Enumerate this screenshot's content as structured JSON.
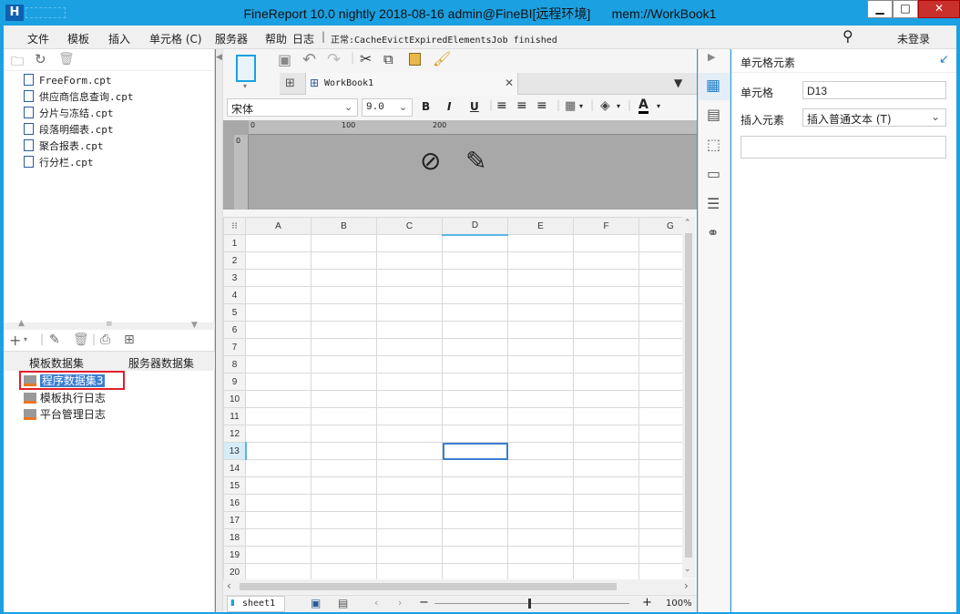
{
  "title": "FineReport 10.0 nightly 2018-08-16 admin@FineBI[远程环境]      mem://WorkBook1",
  "window_controls": {
    "minimize": "▁",
    "maximize": "□",
    "close": "✕"
  },
  "menu": {
    "items": [
      "文件",
      "模板",
      "插入",
      "单元格 (C)",
      "服务器",
      "帮助"
    ],
    "log": "日志",
    "status": "正常:CacheEvictExpiredElementsJob finished",
    "login": "未登录"
  },
  "files": [
    "FreeForm.cpt",
    "供应商信息查询.cpt",
    "分片与冻结.cpt",
    "段落明细表.cpt",
    "聚合报表.cpt",
    "行分栏.cpt"
  ],
  "dataset_tabs": [
    "模板数据集",
    "服务器数据集"
  ],
  "datasets": [
    "程序数据集3",
    "模板执行日志",
    "平台管理日志"
  ],
  "editor": {
    "tab_name": "WorkBook1",
    "font_name": "宋体",
    "font_size": "9.0",
    "bold": "B",
    "italic": "I",
    "underline": "U",
    "ruler": [
      "0",
      "100",
      "200"
    ],
    "vruler": "0"
  },
  "grid": {
    "columns": [
      "A",
      "B",
      "C",
      "D",
      "E",
      "F",
      "G"
    ],
    "rows": [
      "1",
      "2",
      "3",
      "4",
      "5",
      "6",
      "7",
      "8",
      "9",
      "10",
      "11",
      "12",
      "13",
      "14",
      "15",
      "16",
      "17",
      "18",
      "19",
      "20"
    ],
    "selected_cell": "D13"
  },
  "bottom": {
    "sheet": "sheet1",
    "zoom": "100%",
    "minus": "−",
    "plus": "+"
  },
  "right_panel": {
    "title": "单元格元素",
    "cell_label": "单元格",
    "cell_value": "D13",
    "insert_label": "插入元素",
    "insert_value": "插入普通文本 (T)"
  },
  "colors": {
    "accent": "#1ba0e1",
    "selection": "#3c7fd1",
    "highlight_red": "#e0202a"
  }
}
